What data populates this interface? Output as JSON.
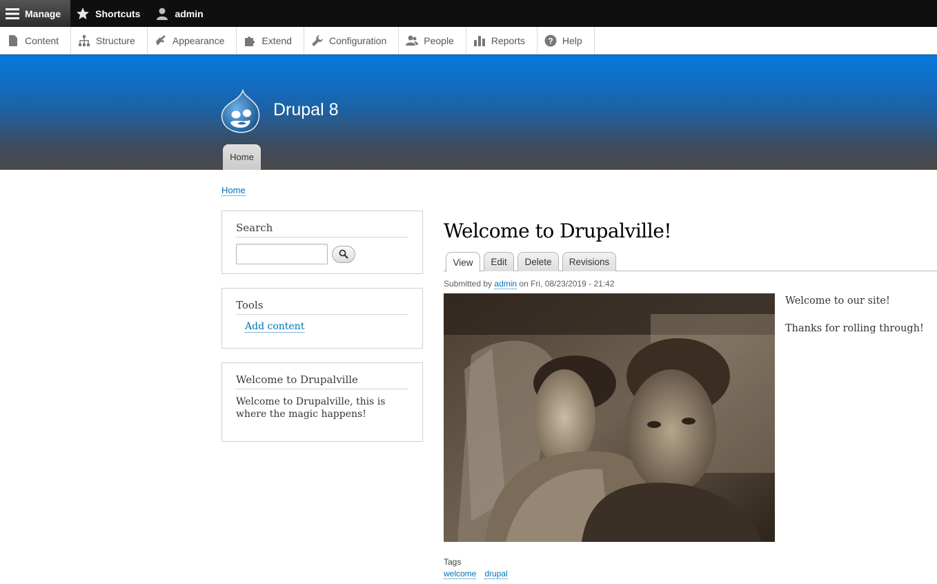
{
  "toolbar": {
    "manage": "Manage",
    "shortcuts": "Shortcuts",
    "user": "admin"
  },
  "tray": {
    "items": [
      {
        "label": "Content",
        "icon": "file-icon"
      },
      {
        "label": "Structure",
        "icon": "sitemap-icon"
      },
      {
        "label": "Appearance",
        "icon": "paintbrush-icon"
      },
      {
        "label": "Extend",
        "icon": "puzzle-icon"
      },
      {
        "label": "Configuration",
        "icon": "wrench-icon"
      },
      {
        "label": "People",
        "icon": "people-icon"
      },
      {
        "label": "Reports",
        "icon": "bar-chart-icon"
      },
      {
        "label": "Help",
        "icon": "help-icon"
      }
    ]
  },
  "header": {
    "site_name": "Drupal 8",
    "home_tab": "Home"
  },
  "breadcrumb": {
    "home": "Home"
  },
  "sidebar": {
    "search": {
      "title": "Search",
      "placeholder": ""
    },
    "tools": {
      "title": "Tools",
      "link": "Add content"
    },
    "welcome": {
      "title": "Welcome to Drupalville",
      "text": "Welcome to Drupalville, this is where the magic happens!"
    }
  },
  "node": {
    "title": "Welcome to Drupalville!",
    "tabs": [
      "View",
      "Edit",
      "Delete",
      "Revisions"
    ],
    "submitted_prefix": "Submitted by",
    "author": "admin",
    "submitted_suffix": "on Fri, 08/23/2019 - 21:42",
    "body": [
      "Welcome to our site!",
      "Thanks for rolling through!"
    ],
    "tags_label": "Tags",
    "tags": [
      "welcome",
      "drupal"
    ]
  },
  "colors": {
    "link": "#0071b3",
    "header_top": "#0779e0",
    "header_bottom": "#4a4a4a",
    "toolbar": "#0f0f0f"
  }
}
